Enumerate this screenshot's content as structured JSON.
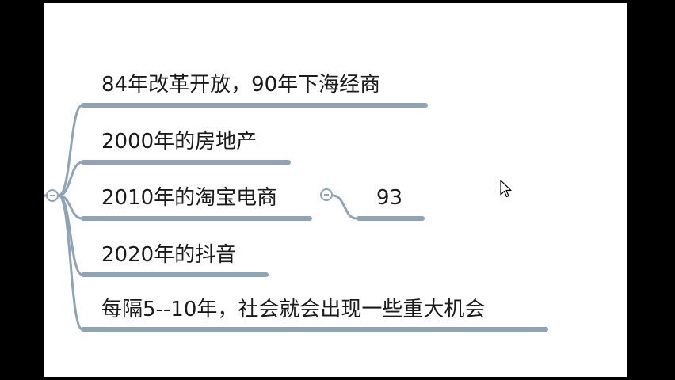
{
  "mindmap": {
    "branches": [
      {
        "label": "84年改革开放，90年下海经商"
      },
      {
        "label": "2000年的房地产"
      },
      {
        "label": "2010年的淘宝电商",
        "child": "93"
      },
      {
        "label": "2020年的抖音"
      },
      {
        "label": "每隔5--10年，社会就会出现一些重大机会"
      }
    ]
  },
  "colors": {
    "connector": "#8ea2b8",
    "background": "#ffffff",
    "frame": "#000000"
  },
  "icons": {
    "collapse": "collapse-minus-icon",
    "cursor": "mouse-pointer-icon"
  }
}
